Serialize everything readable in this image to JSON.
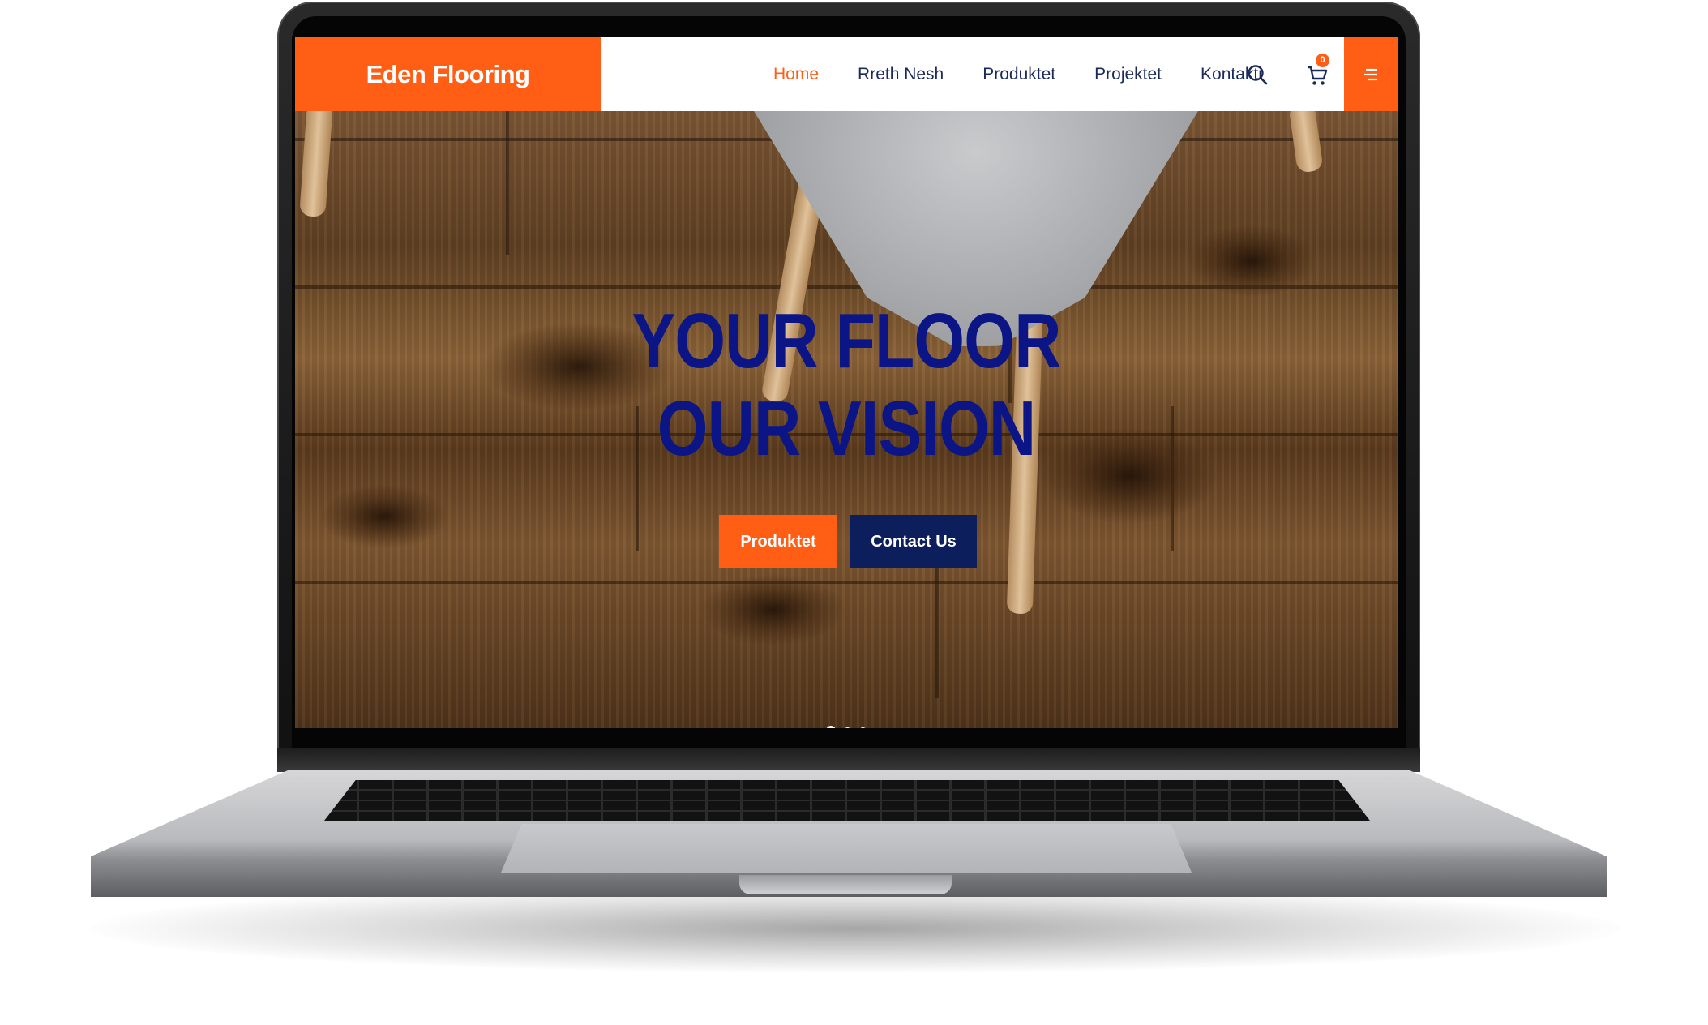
{
  "brand": {
    "name": "Eden Flooring"
  },
  "nav": {
    "items": [
      {
        "label": "Home",
        "active": true
      },
      {
        "label": "Rreth Nesh",
        "active": false
      },
      {
        "label": "Produktet",
        "active": false
      },
      {
        "label": "Projektet",
        "active": false
      },
      {
        "label": "Kontakti",
        "active": false
      }
    ],
    "cart_count": "0"
  },
  "hero": {
    "title_line1": "YOUR FLOOR",
    "title_line2": "OUR VISION",
    "primary_button": "Produktet",
    "secondary_button": "Contact Us",
    "slide_count": 3,
    "active_slide": 1
  },
  "icons": {
    "search": "search-icon",
    "cart": "cart-icon",
    "menu": "menu-icon",
    "prev": "chevron-left-icon",
    "next": "chevron-right-icon"
  },
  "colors": {
    "accent": "#ff5e14",
    "navy": "#0c1f5c",
    "title": "#0c1585",
    "nav_text": "#1c2a5a"
  },
  "arrows": {
    "prev": "‹",
    "next": "›"
  }
}
